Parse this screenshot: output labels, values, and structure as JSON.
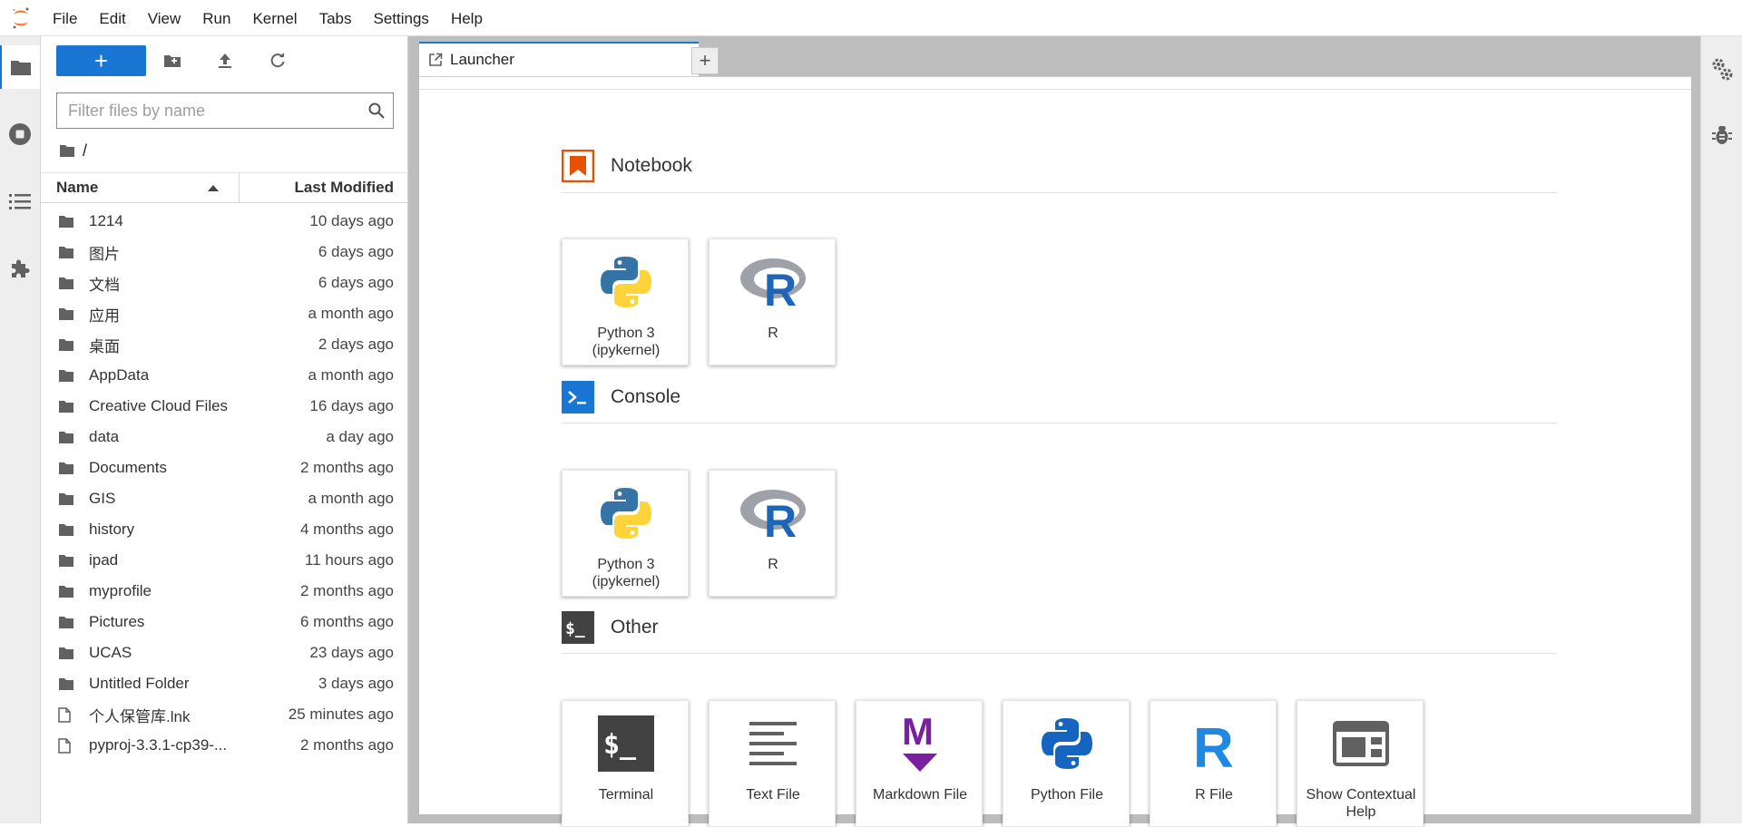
{
  "menubar": {
    "items": [
      "File",
      "Edit",
      "View",
      "Run",
      "Kernel",
      "Tabs",
      "Settings",
      "Help"
    ]
  },
  "filebrowser": {
    "filter_placeholder": "Filter files by name",
    "breadcrumb": "/",
    "columns": {
      "name": "Name",
      "modified": "Last Modified"
    },
    "files": [
      {
        "name": "1214",
        "modified": "10 days ago",
        "type": "folder"
      },
      {
        "name": "图片",
        "modified": "6 days ago",
        "type": "folder"
      },
      {
        "name": "文档",
        "modified": "6 days ago",
        "type": "folder"
      },
      {
        "name": "应用",
        "modified": "a month ago",
        "type": "folder"
      },
      {
        "name": "桌面",
        "modified": "2 days ago",
        "type": "folder"
      },
      {
        "name": "AppData",
        "modified": "a month ago",
        "type": "folder"
      },
      {
        "name": "Creative Cloud Files",
        "modified": "16 days ago",
        "type": "folder"
      },
      {
        "name": "data",
        "modified": "a day ago",
        "type": "folder"
      },
      {
        "name": "Documents",
        "modified": "2 months ago",
        "type": "folder"
      },
      {
        "name": "GIS",
        "modified": "a month ago",
        "type": "folder"
      },
      {
        "name": "history",
        "modified": "4 months ago",
        "type": "folder"
      },
      {
        "name": "ipad",
        "modified": "11 hours ago",
        "type": "folder"
      },
      {
        "name": "myprofile",
        "modified": "2 months ago",
        "type": "folder"
      },
      {
        "name": "Pictures",
        "modified": "6 months ago",
        "type": "folder"
      },
      {
        "name": "UCAS",
        "modified": "23 days ago",
        "type": "folder"
      },
      {
        "name": "Untitled Folder",
        "modified": "3 days ago",
        "type": "folder"
      },
      {
        "name": "个人保管库.lnk",
        "modified": "25 minutes ago",
        "type": "file"
      },
      {
        "name": "pyproj-3.3.1-cp39-...",
        "modified": "2 months ago",
        "type": "file"
      }
    ]
  },
  "tabs": {
    "launcher_label": "Launcher",
    "add_label": "+"
  },
  "launcher": {
    "notebook": {
      "title": "Notebook",
      "cards": [
        {
          "label": "Python 3\n(ipykernel)",
          "icon": "python-logo-icon"
        },
        {
          "label": "R",
          "icon": "r-logo-icon"
        }
      ]
    },
    "console": {
      "title": "Console",
      "cards": [
        {
          "label": "Python 3\n(ipykernel)",
          "icon": "python-logo-icon"
        },
        {
          "label": "R",
          "icon": "r-logo-icon"
        }
      ]
    },
    "other": {
      "title": "Other",
      "cards": [
        {
          "label": "Terminal",
          "icon": "terminal-icon"
        },
        {
          "label": "Text File",
          "icon": "text-file-icon"
        },
        {
          "label": "Markdown File",
          "icon": "markdown-icon"
        },
        {
          "label": "Python File",
          "icon": "python-file-icon"
        },
        {
          "label": "R File",
          "icon": "r-file-icon"
        },
        {
          "label": "Show Contextual Help",
          "icon": "contextual-help-icon"
        }
      ]
    }
  },
  "colors": {
    "accent": "#1976d2",
    "notebook_icon": "#e65100",
    "console_icon": "#1976d2",
    "other_icon": "#424242",
    "markdown": "#7b1fa2"
  }
}
